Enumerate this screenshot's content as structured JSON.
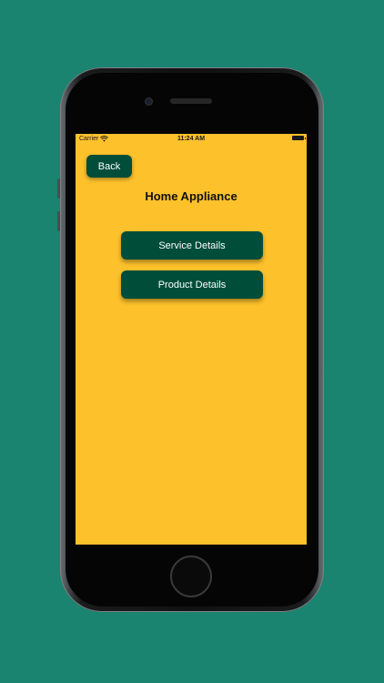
{
  "status_bar": {
    "carrier": "Carrier",
    "time": "11:24 AM"
  },
  "screen": {
    "back_label": "Back",
    "title": "Home Appliance",
    "buttons": [
      {
        "label": "Service Details"
      },
      {
        "label": "Product Details"
      }
    ]
  },
  "colors": {
    "background": "#1b8470",
    "screen": "#fcc12b",
    "button": "#004d3a",
    "button_text": "#ffffff"
  },
  "icons": {
    "wifi": "wifi-icon",
    "battery": "battery-icon"
  }
}
